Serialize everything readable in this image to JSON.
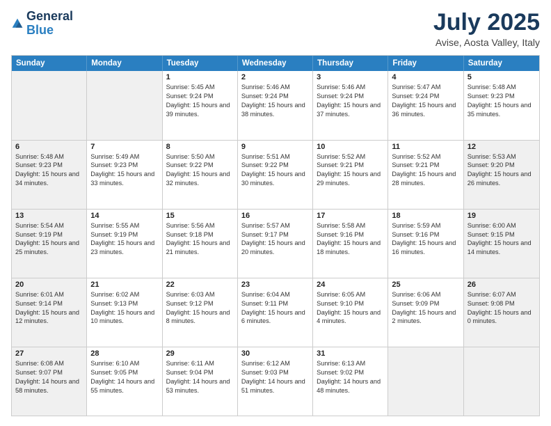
{
  "header": {
    "logo_line1": "General",
    "logo_line2": "Blue",
    "month": "July 2025",
    "location": "Avise, Aosta Valley, Italy"
  },
  "weekdays": [
    "Sunday",
    "Monday",
    "Tuesday",
    "Wednesday",
    "Thursday",
    "Friday",
    "Saturday"
  ],
  "rows": [
    [
      {
        "day": "",
        "sunrise": "",
        "sunset": "",
        "daylight": "",
        "shaded": true
      },
      {
        "day": "",
        "sunrise": "",
        "sunset": "",
        "daylight": "",
        "shaded": true
      },
      {
        "day": "1",
        "sunrise": "Sunrise: 5:45 AM",
        "sunset": "Sunset: 9:24 PM",
        "daylight": "Daylight: 15 hours and 39 minutes.",
        "shaded": false
      },
      {
        "day": "2",
        "sunrise": "Sunrise: 5:46 AM",
        "sunset": "Sunset: 9:24 PM",
        "daylight": "Daylight: 15 hours and 38 minutes.",
        "shaded": false
      },
      {
        "day": "3",
        "sunrise": "Sunrise: 5:46 AM",
        "sunset": "Sunset: 9:24 PM",
        "daylight": "Daylight: 15 hours and 37 minutes.",
        "shaded": false
      },
      {
        "day": "4",
        "sunrise": "Sunrise: 5:47 AM",
        "sunset": "Sunset: 9:24 PM",
        "daylight": "Daylight: 15 hours and 36 minutes.",
        "shaded": false
      },
      {
        "day": "5",
        "sunrise": "Sunrise: 5:48 AM",
        "sunset": "Sunset: 9:23 PM",
        "daylight": "Daylight: 15 hours and 35 minutes.",
        "shaded": false
      }
    ],
    [
      {
        "day": "6",
        "sunrise": "Sunrise: 5:48 AM",
        "sunset": "Sunset: 9:23 PM",
        "daylight": "Daylight: 15 hours and 34 minutes.",
        "shaded": true
      },
      {
        "day": "7",
        "sunrise": "Sunrise: 5:49 AM",
        "sunset": "Sunset: 9:23 PM",
        "daylight": "Daylight: 15 hours and 33 minutes.",
        "shaded": false
      },
      {
        "day": "8",
        "sunrise": "Sunrise: 5:50 AM",
        "sunset": "Sunset: 9:22 PM",
        "daylight": "Daylight: 15 hours and 32 minutes.",
        "shaded": false
      },
      {
        "day": "9",
        "sunrise": "Sunrise: 5:51 AM",
        "sunset": "Sunset: 9:22 PM",
        "daylight": "Daylight: 15 hours and 30 minutes.",
        "shaded": false
      },
      {
        "day": "10",
        "sunrise": "Sunrise: 5:52 AM",
        "sunset": "Sunset: 9:21 PM",
        "daylight": "Daylight: 15 hours and 29 minutes.",
        "shaded": false
      },
      {
        "day": "11",
        "sunrise": "Sunrise: 5:52 AM",
        "sunset": "Sunset: 9:21 PM",
        "daylight": "Daylight: 15 hours and 28 minutes.",
        "shaded": false
      },
      {
        "day": "12",
        "sunrise": "Sunrise: 5:53 AM",
        "sunset": "Sunset: 9:20 PM",
        "daylight": "Daylight: 15 hours and 26 minutes.",
        "shaded": true
      }
    ],
    [
      {
        "day": "13",
        "sunrise": "Sunrise: 5:54 AM",
        "sunset": "Sunset: 9:19 PM",
        "daylight": "Daylight: 15 hours and 25 minutes.",
        "shaded": true
      },
      {
        "day": "14",
        "sunrise": "Sunrise: 5:55 AM",
        "sunset": "Sunset: 9:19 PM",
        "daylight": "Daylight: 15 hours and 23 minutes.",
        "shaded": false
      },
      {
        "day": "15",
        "sunrise": "Sunrise: 5:56 AM",
        "sunset": "Sunset: 9:18 PM",
        "daylight": "Daylight: 15 hours and 21 minutes.",
        "shaded": false
      },
      {
        "day": "16",
        "sunrise": "Sunrise: 5:57 AM",
        "sunset": "Sunset: 9:17 PM",
        "daylight": "Daylight: 15 hours and 20 minutes.",
        "shaded": false
      },
      {
        "day": "17",
        "sunrise": "Sunrise: 5:58 AM",
        "sunset": "Sunset: 9:16 PM",
        "daylight": "Daylight: 15 hours and 18 minutes.",
        "shaded": false
      },
      {
        "day": "18",
        "sunrise": "Sunrise: 5:59 AM",
        "sunset": "Sunset: 9:16 PM",
        "daylight": "Daylight: 15 hours and 16 minutes.",
        "shaded": false
      },
      {
        "day": "19",
        "sunrise": "Sunrise: 6:00 AM",
        "sunset": "Sunset: 9:15 PM",
        "daylight": "Daylight: 15 hours and 14 minutes.",
        "shaded": true
      }
    ],
    [
      {
        "day": "20",
        "sunrise": "Sunrise: 6:01 AM",
        "sunset": "Sunset: 9:14 PM",
        "daylight": "Daylight: 15 hours and 12 minutes.",
        "shaded": true
      },
      {
        "day": "21",
        "sunrise": "Sunrise: 6:02 AM",
        "sunset": "Sunset: 9:13 PM",
        "daylight": "Daylight: 15 hours and 10 minutes.",
        "shaded": false
      },
      {
        "day": "22",
        "sunrise": "Sunrise: 6:03 AM",
        "sunset": "Sunset: 9:12 PM",
        "daylight": "Daylight: 15 hours and 8 minutes.",
        "shaded": false
      },
      {
        "day": "23",
        "sunrise": "Sunrise: 6:04 AM",
        "sunset": "Sunset: 9:11 PM",
        "daylight": "Daylight: 15 hours and 6 minutes.",
        "shaded": false
      },
      {
        "day": "24",
        "sunrise": "Sunrise: 6:05 AM",
        "sunset": "Sunset: 9:10 PM",
        "daylight": "Daylight: 15 hours and 4 minutes.",
        "shaded": false
      },
      {
        "day": "25",
        "sunrise": "Sunrise: 6:06 AM",
        "sunset": "Sunset: 9:09 PM",
        "daylight": "Daylight: 15 hours and 2 minutes.",
        "shaded": false
      },
      {
        "day": "26",
        "sunrise": "Sunrise: 6:07 AM",
        "sunset": "Sunset: 9:08 PM",
        "daylight": "Daylight: 15 hours and 0 minutes.",
        "shaded": true
      }
    ],
    [
      {
        "day": "27",
        "sunrise": "Sunrise: 6:08 AM",
        "sunset": "Sunset: 9:07 PM",
        "daylight": "Daylight: 14 hours and 58 minutes.",
        "shaded": true
      },
      {
        "day": "28",
        "sunrise": "Sunrise: 6:10 AM",
        "sunset": "Sunset: 9:05 PM",
        "daylight": "Daylight: 14 hours and 55 minutes.",
        "shaded": false
      },
      {
        "day": "29",
        "sunrise": "Sunrise: 6:11 AM",
        "sunset": "Sunset: 9:04 PM",
        "daylight": "Daylight: 14 hours and 53 minutes.",
        "shaded": false
      },
      {
        "day": "30",
        "sunrise": "Sunrise: 6:12 AM",
        "sunset": "Sunset: 9:03 PM",
        "daylight": "Daylight: 14 hours and 51 minutes.",
        "shaded": false
      },
      {
        "day": "31",
        "sunrise": "Sunrise: 6:13 AM",
        "sunset": "Sunset: 9:02 PM",
        "daylight": "Daylight: 14 hours and 48 minutes.",
        "shaded": false
      },
      {
        "day": "",
        "sunrise": "",
        "sunset": "",
        "daylight": "",
        "shaded": true
      },
      {
        "day": "",
        "sunrise": "",
        "sunset": "",
        "daylight": "",
        "shaded": true
      }
    ]
  ]
}
